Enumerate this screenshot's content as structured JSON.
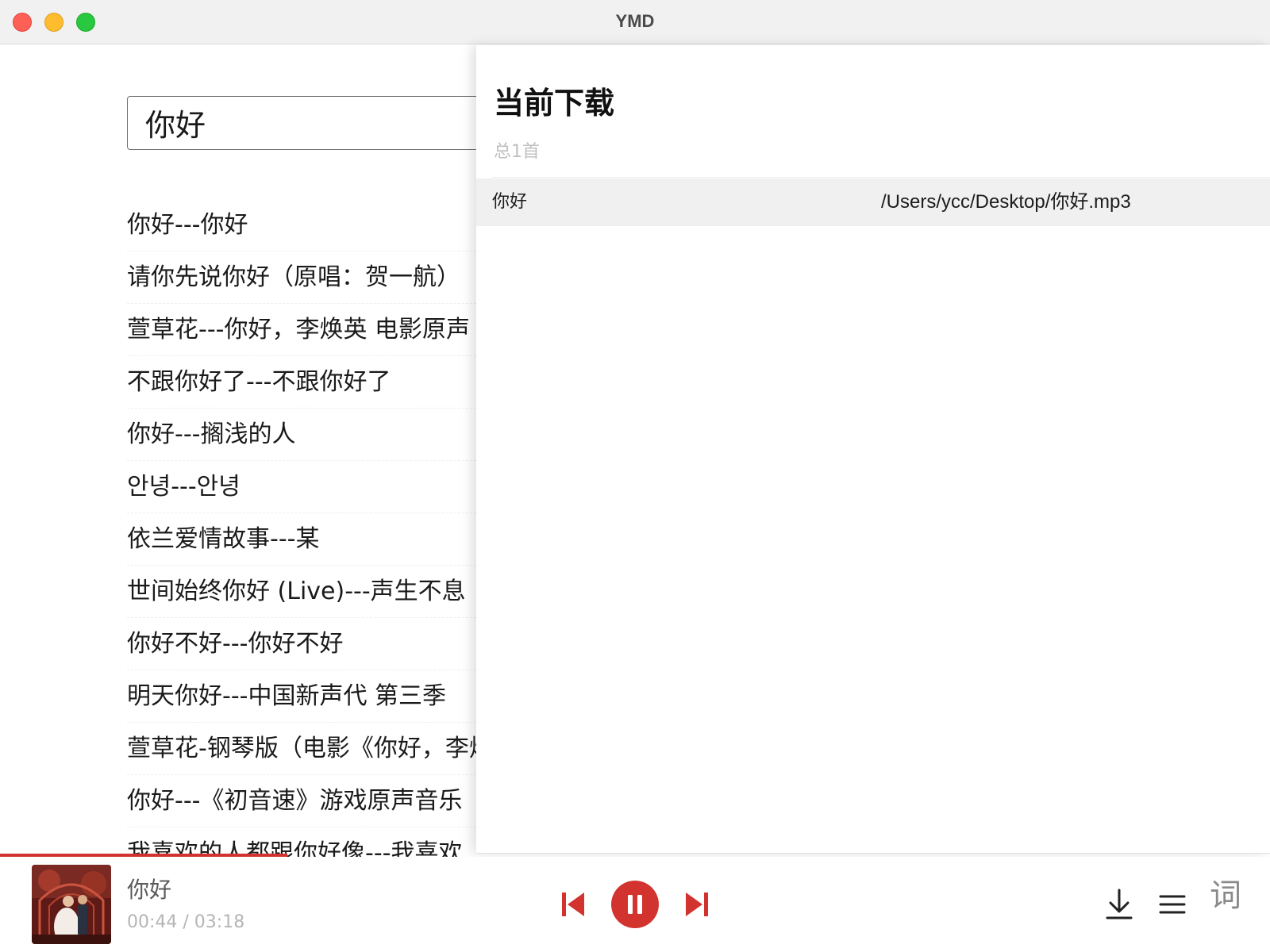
{
  "window": {
    "title": "YMD"
  },
  "search": {
    "value": "你好"
  },
  "results": [
    {
      "label": "你好---你好"
    },
    {
      "label": "请你先说你好（原唱：贺一航）"
    },
    {
      "label": "萱草花---你好，李焕英 电影原声"
    },
    {
      "label": "不跟你好了---不跟你好了"
    },
    {
      "label": "你好---搁浅的人"
    },
    {
      "label": "안녕---안녕"
    },
    {
      "label": "依兰爱情故事---某"
    },
    {
      "label": "世间始终你好 (Live)---声生不息"
    },
    {
      "label": "你好不好---你好不好"
    },
    {
      "label": "明天你好---中国新声代 第三季"
    },
    {
      "label": "萱草花-钢琴版（电影《你好，李焕英》）"
    },
    {
      "label": "你好---《初音速》游戏原声音乐"
    },
    {
      "label": "我喜欢的人都跟你好像---我喜欢"
    }
  ],
  "download_panel": {
    "title": "当前下载",
    "count_text": "总1首",
    "items": [
      {
        "name": "你好",
        "path": "/Users/ycc/Desktop/你好.mp3"
      }
    ]
  },
  "player": {
    "track_title": "你好",
    "time_text": "00:44 / 03:18",
    "progress_fraction": 0.226,
    "lyrics_label": "词",
    "icons": {
      "prev": "skip-previous-icon",
      "pause": "pause-icon",
      "next": "skip-next-icon",
      "download": "download-icon",
      "queue": "playlist-icon"
    }
  },
  "colors": {
    "accent": "#d2332e",
    "titlebar_bg": "#f1f1f1",
    "panel_row_bg": "#f0f0f0",
    "muted_text": "#b5b5b5"
  }
}
